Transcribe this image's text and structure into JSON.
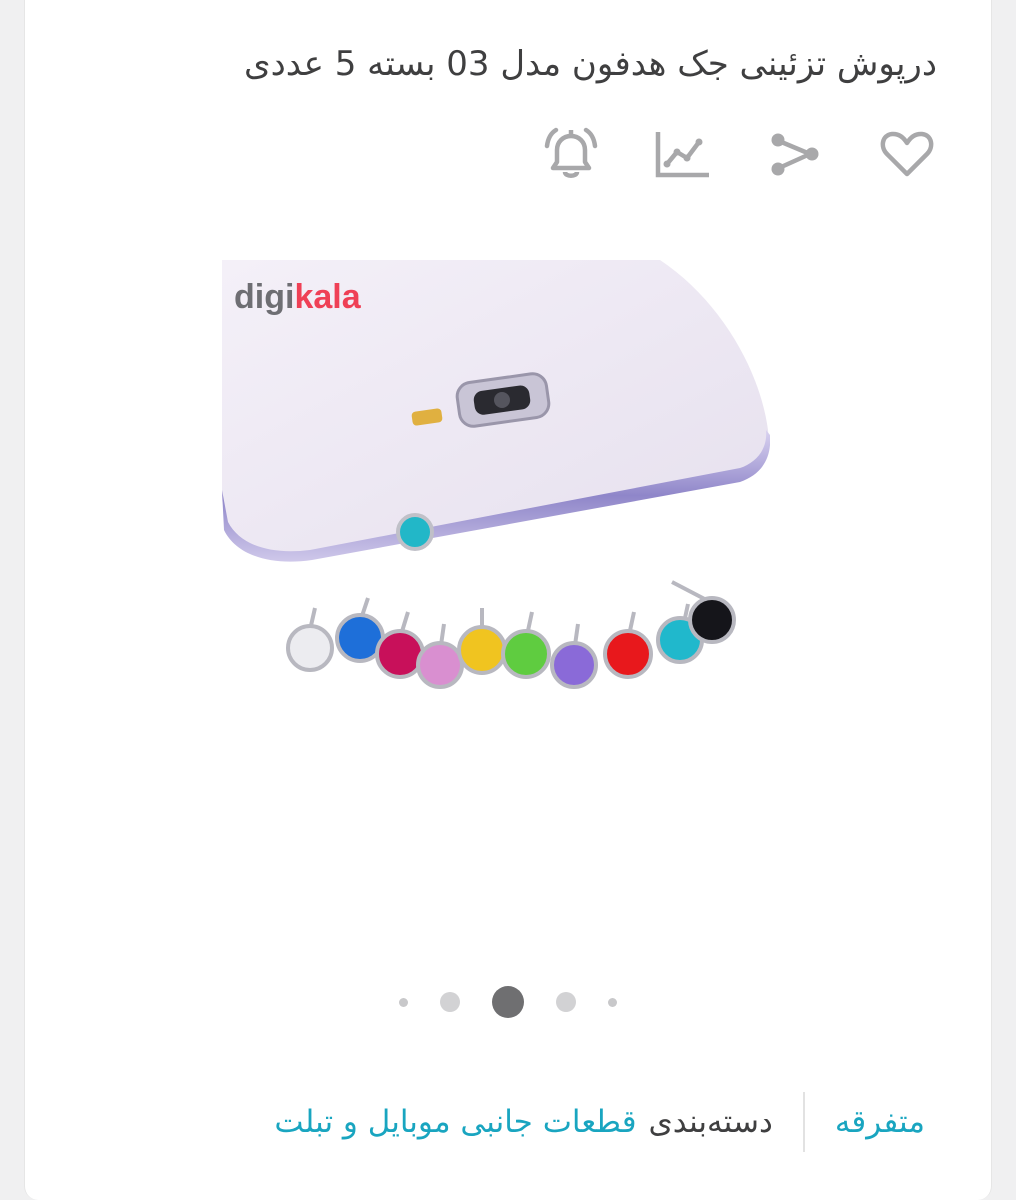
{
  "product": {
    "title": "درپوش تزئینی جک هدفون مدل 03 بسته 5 عددی"
  },
  "actions": [
    {
      "name": "favorite",
      "icon": "heart-icon"
    },
    {
      "name": "share",
      "icon": "share-icon"
    },
    {
      "name": "price-chart",
      "icon": "chart-icon"
    },
    {
      "name": "notify",
      "icon": "bell-icon"
    }
  ],
  "gallery": {
    "watermark_prefix": "digi",
    "watermark_suffix": "kala",
    "active_index": 2,
    "slide_count": 5
  },
  "meta": {
    "brand": "متفرقه",
    "category_label": "دسته‌بندی",
    "category_value": "قطعات جانبی موبایل و تبلت"
  },
  "colors": {
    "accent": "#19a5c0",
    "text": "#3f3f40",
    "icon": "#a8a8aa"
  }
}
